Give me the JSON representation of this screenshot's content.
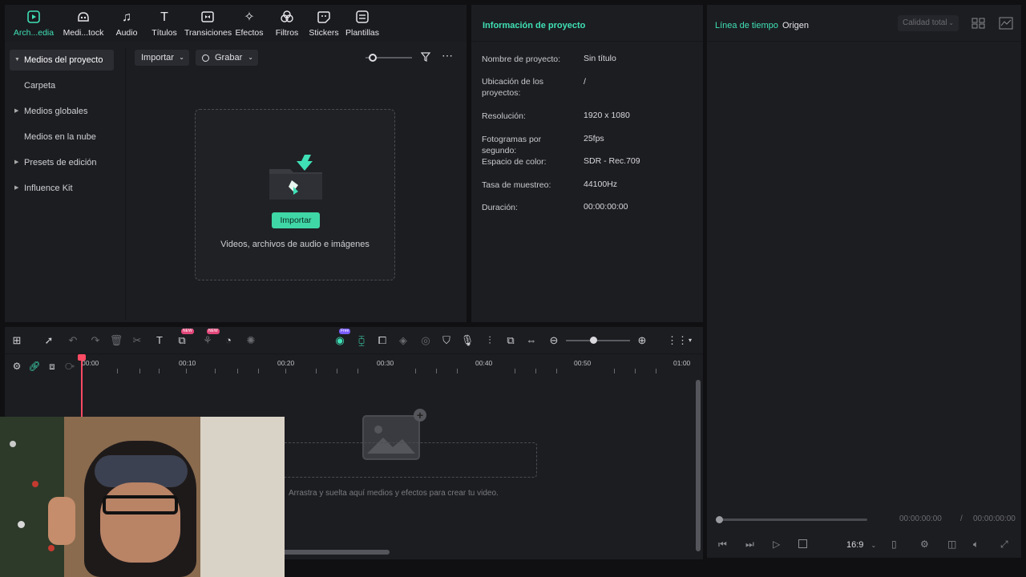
{
  "colors": {
    "accent": "#3fe0b6",
    "panel": "#1c1d21",
    "playhead": "#ff4b64"
  },
  "tabs": [
    {
      "label": "Arch...edia",
      "icon": "media-icon",
      "active": true
    },
    {
      "label": "Medi...tock",
      "icon": "stock-media-icon"
    },
    {
      "label": "Audio",
      "icon": "music-note-icon"
    },
    {
      "label": "Títulos",
      "icon": "text-icon"
    },
    {
      "label": "Transiciones",
      "icon": "transition-icon"
    },
    {
      "label": "Efectos",
      "icon": "effects-icon"
    },
    {
      "label": "Filtros",
      "icon": "filter-icon"
    },
    {
      "label": "Stickers",
      "icon": "sticker-icon"
    },
    {
      "label": "Plantillas",
      "icon": "template-icon"
    }
  ],
  "sidebar": {
    "items": [
      {
        "label": "Medios del proyecto",
        "expanded": true
      },
      {
        "label": "Carpeta"
      },
      {
        "label": "Medios globales"
      },
      {
        "label": "Medios en la nube"
      },
      {
        "label": "Presets de edición"
      },
      {
        "label": "Influence Kit"
      }
    ]
  },
  "toolbar": {
    "import_label": "Importar",
    "record_label": "Grabar"
  },
  "dropzone": {
    "button_label": "Importar",
    "hint": "Videos, archivos de audio e imágenes"
  },
  "info": {
    "title": "Información de proyecto",
    "rows": [
      {
        "key": "Nombre de proyecto:",
        "value": "Sin título"
      },
      {
        "key": "Ubicación de los proyectos:",
        "value": "/"
      },
      {
        "key": "Resolución:",
        "value": "1920 x 1080"
      },
      {
        "key": "Fotogramas por segundo:",
        "value": "25fps"
      },
      {
        "key": "Espacio de color:",
        "value": "SDR - Rec.709"
      },
      {
        "key": "Tasa de muestreo:",
        "value": "44100Hz"
      },
      {
        "key": "Duración:",
        "value": "00:00:00:00"
      }
    ]
  },
  "preview": {
    "tab_timeline": "Línea de tiempo",
    "tab_source": "Origen",
    "quality": "Calidad total",
    "time_current": "00:00:00:00",
    "time_sep": "/",
    "time_total": "00:00:00:00",
    "aspect": "16:9"
  },
  "timeline": {
    "ruler": [
      "00:00",
      "00:10",
      "00:20",
      "00:30",
      "00:40",
      "00:50",
      "01:00"
    ],
    "drop_hint": "Arrastra y suelta aquí medios y efectos para crear tu video.",
    "badge_new": "NEW",
    "badge_free": "Free"
  }
}
